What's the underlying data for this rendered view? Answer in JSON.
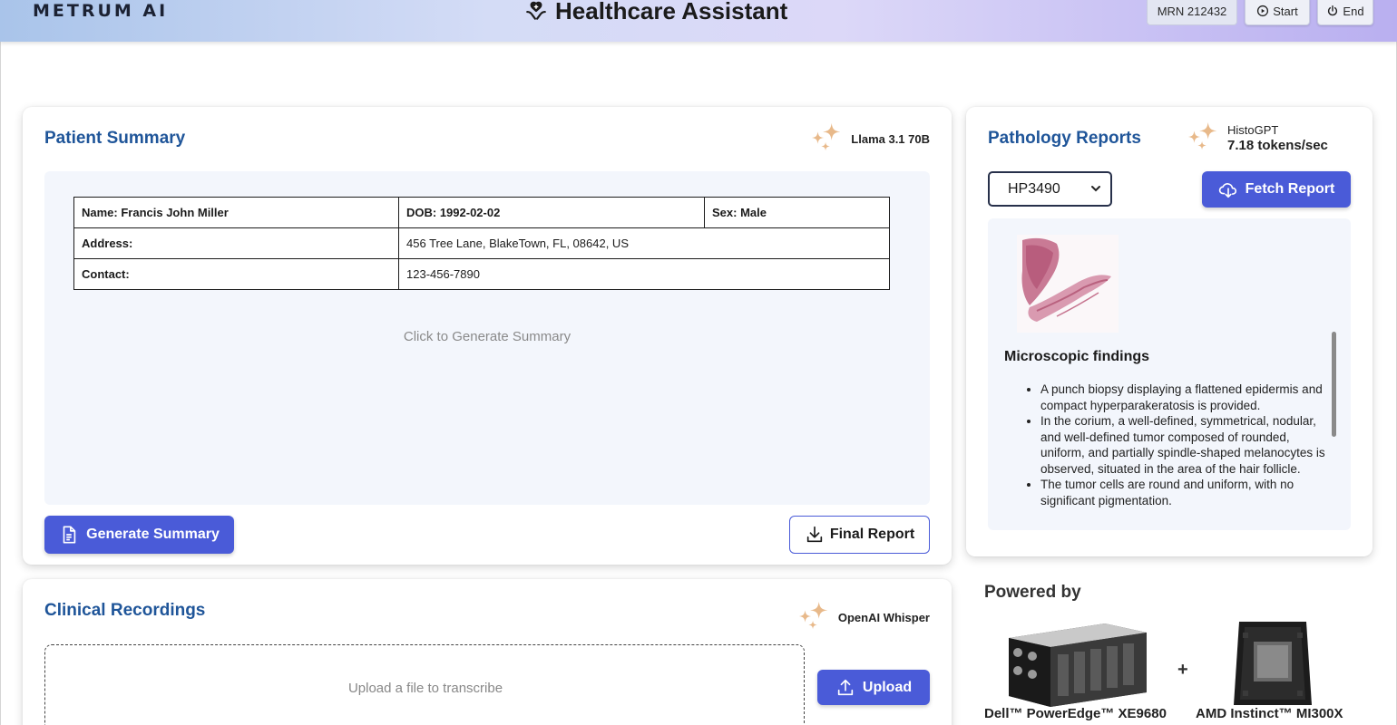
{
  "header": {
    "logo": "METRUM AI",
    "title": "Healthcare Assistant",
    "mrn": "MRN 212432",
    "start_label": "Start",
    "end_label": "End"
  },
  "patient_summary": {
    "title": "Patient Summary",
    "model": "Llama 3.1 70B",
    "table": {
      "name": "Name: Francis John Miller",
      "dob": "DOB: 1992-02-02",
      "sex": "Sex: Male",
      "address_label": "Address:",
      "address_value": "456 Tree Lane, BlakeTown, FL, 08642, US",
      "contact_label": "Contact:",
      "contact_value": "123-456-7890"
    },
    "placeholder": "Click to Generate Summary",
    "generate_label": "Generate Summary",
    "final_report_label": "Final Report"
  },
  "pathology": {
    "title": "Pathology Reports",
    "model": "HistoGPT",
    "speed": "7.18 tokens/sec",
    "selected_report": "HP3490",
    "fetch_label": "Fetch Report",
    "findings_title": "Microscopic findings",
    "findings": [
      "A punch biopsy displaying a flattened epidermis and compact hyperparakeratosis is provided.",
      "In the corium, a well-defined, symmetrical, nodular, and well-defined tumor composed of rounded, uniform, and partially spindle-shaped melanocytes is observed, situated in the area of the hair follicle.",
      "The tumor cells are round and uniform, with no significant pigmentation."
    ]
  },
  "clinical": {
    "title": "Clinical Recordings",
    "model": "OpenAI Whisper",
    "upload_placeholder": "Upload a file to transcribe",
    "upload_label": "Upload"
  },
  "powered": {
    "title": "Powered by",
    "plus": "+",
    "server_label": "Dell™ PowerEdge™ XE9680",
    "chip_label": "AMD Instinct™ MI300X"
  },
  "colors": {
    "accent": "#4a5bd8",
    "title_blue": "#1f5599",
    "panel_bg": "#f3f6fc"
  }
}
